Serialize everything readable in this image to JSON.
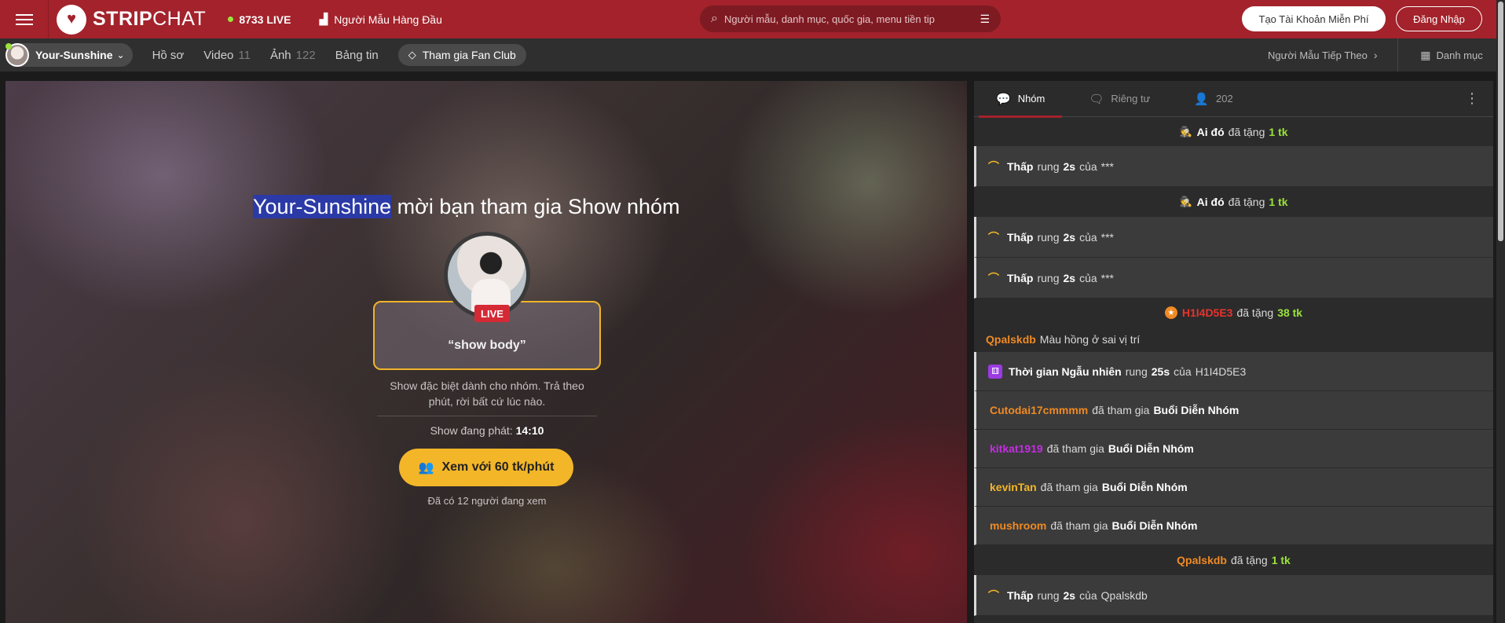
{
  "header": {
    "brand_strong": "STRIP",
    "brand_rest": "CHAT",
    "live_count": "8733 LIVE",
    "top_models_label": "Người Mẫu Hàng Đầu",
    "search_placeholder": "Người mẫu, danh mục, quốc gia, menu tiền tip",
    "create_account_label": "Tạo Tài Khoản Miễn Phí",
    "login_label": "Đăng Nhập",
    "accent_color": "#a3222b"
  },
  "subnav": {
    "model_name": "Your-Sunshine",
    "items": [
      {
        "label": "Hồ sơ",
        "count": ""
      },
      {
        "label": "Video",
        "count": "11"
      },
      {
        "label": "Ảnh",
        "count": "122"
      },
      {
        "label": "Bảng tin",
        "count": ""
      }
    ],
    "fanclub_label": "Tham gia Fan Club",
    "next_model_label": "Người Mẫu Tiếp Theo",
    "categories_label": "Danh mục"
  },
  "show": {
    "model_name": "Your-Sunshine",
    "invite_rest": " mời bạn tham gia Show nhóm",
    "live_badge": "LIVE",
    "topic": "“show body”",
    "description": "Show đặc biệt dành cho nhóm. Trả theo phút, rời bất cứ lúc nào.",
    "time_label": "Show đang phát: ",
    "time_value": "14:10",
    "watch_button": "Xem với 60 tk/phút",
    "viewers": "Đã có 12 người đang xem",
    "highlight_color": "#f3b628"
  },
  "chat": {
    "tabs": [
      {
        "label": "Nhóm",
        "icon": "chat-bubble-icon"
      },
      {
        "label": "Riêng tư",
        "icon": "private-chat-icon"
      },
      {
        "label": "202",
        "icon": "user-icon"
      }
    ],
    "messages": {
      "m1": {
        "name": "Ai đó",
        "text": "đã tặng",
        "amount": "1 tk"
      },
      "m2": {
        "level": "Thấp",
        "verb": "rung",
        "dur": "2s",
        "of": "của",
        "who": "***"
      },
      "m3": {
        "name": "Ai đó",
        "text": "đã tặng",
        "amount": "1 tk"
      },
      "m4": {
        "level": "Thấp",
        "verb": "rung",
        "dur": "2s",
        "of": "của",
        "who": "***"
      },
      "m5": {
        "level": "Thấp",
        "verb": "rung",
        "dur": "2s",
        "of": "của",
        "who": "***"
      },
      "m6": {
        "name": "H1I4D5E3",
        "text": "đã tặng",
        "amount": "38 tk"
      },
      "m7": {
        "name": "Qpalskdb",
        "text": "Màu hồng ở sai vị trí"
      },
      "m8": {
        "level": "Thời gian Ngẫu nhiên",
        "verb": "rung",
        "dur": "25s",
        "of": "của",
        "who": "H1I4D5E3"
      },
      "m9": {
        "name": "Cutodai17cmmmm",
        "text": "đã tham gia",
        "show": "Buổi Diễn Nhóm"
      },
      "m10": {
        "name": "kitkat1919",
        "text": "đã tham gia",
        "show": "Buổi Diễn Nhóm"
      },
      "m11": {
        "name": "kevinTan",
        "text": "đã tham gia",
        "show": "Buổi Diễn Nhóm"
      },
      "m12": {
        "name": "mushroom",
        "text": "đã tham gia",
        "show": "Buổi Diễn Nhóm"
      },
      "m13": {
        "name": "Qpalskdb",
        "text": "đã tặng",
        "amount": "1 tk"
      },
      "m14": {
        "level": "Thấp",
        "verb": "rung",
        "dur": "2s",
        "of": "của",
        "who": "Qpalskdb"
      }
    }
  }
}
